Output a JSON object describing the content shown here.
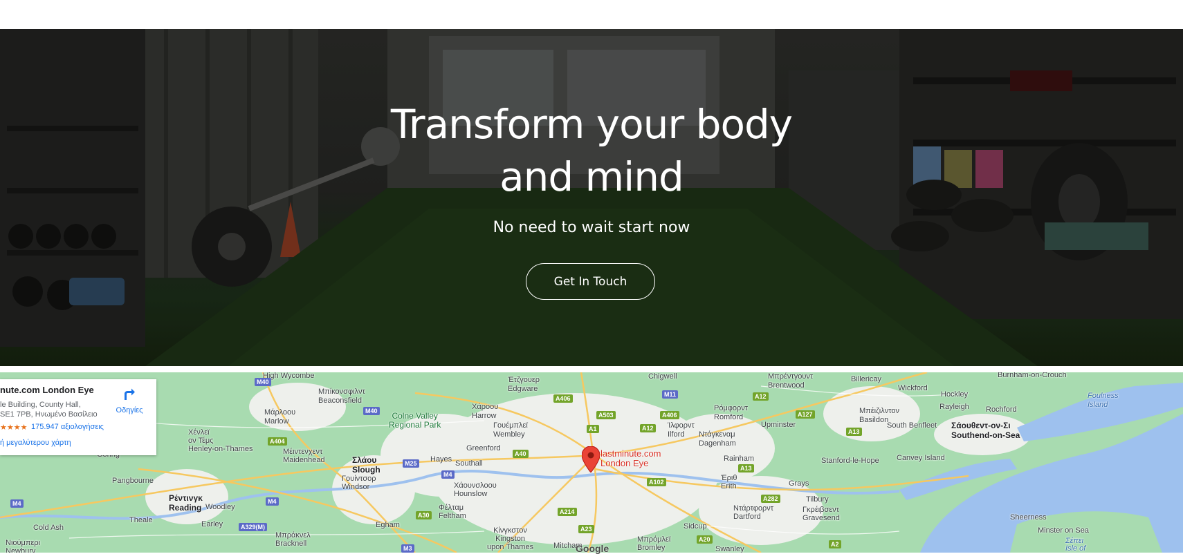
{
  "hero": {
    "title_line1": "Transform your body",
    "title_line2": "and mind",
    "subtitle": "No need to wait start now",
    "cta_label": "Get In Touch"
  },
  "map": {
    "place_card": {
      "name": "nute.com London Eye",
      "address_line1": "le Building, County Hall,",
      "address_line2": "SE1 7PB, Ηνωμένο Βασίλειο",
      "rating_stars": "★★★★",
      "reviews": "175.947 αξιολογήσεις",
      "larger_map": "ή μεγαλύτερου χάρτη",
      "directions_label": "Οδηγίες",
      "directions_icon": "directions-icon"
    },
    "pin_label_line1": "lastminute.com",
    "pin_label_line2": "London Eye",
    "google_logo": "Google",
    "labels": {
      "high_wycombe": "High Wycombe",
      "beaconsfield": "Μπίκονσφιλντ\nBeaconsfield",
      "edgware": "Έτζγουερ\nEdgware",
      "chigwell": "Chigwell",
      "brentwood": "Μπρέντγουντ\nBrentwood",
      "billericay": "Billericay",
      "wickford": "Wickford",
      "burnham": "Burnham-on-Crouch",
      "hockley": "Hockley",
      "rayleigh": "Rayleigh",
      "rochford": "Rochford",
      "foulness": "Foulness\nIsland",
      "basildon": "Μπέιζιλντον\nBasildon",
      "harrow": "Χάροου\nHarrow",
      "romford": "Ρόμφορντ\nRomford",
      "marlow": "Μάρλοου\nMarlow",
      "colne": "Colne Valley\nRegional Park",
      "wembley": "Γουέμπλεϊ\nWembley",
      "ilford": "Ίλφορντ\nIlford",
      "dagenham": "Ντάγκεναμ\nDagenham",
      "upminster": "Upminster",
      "south_benfleet": "South Benfleet",
      "southend": "Σάουθεντ-ον-Σι\nSouthend-on-Sea",
      "henley": "Χένλεϊ\nον Τέμς\nHenley-on-Thames",
      "maidenhead": "Μέιντενχεντ\nMaidenhead",
      "slough": "Σλάου\nSlough",
      "hayes": "Hayes",
      "greenford": "Greenford",
      "southall": "Southall",
      "rainham": "Rainham",
      "stanford": "Stanford-le-Hope",
      "canvey": "Canvey Island",
      "goring": "Goring",
      "pangbourne": "Pangbourne",
      "windsor": "Γουίντσορ\nWindsor",
      "hounslow": "Χάουνσλοου\nHounslow",
      "erith": "Έριθ\nErith",
      "grays": "Grays",
      "reading": "Ρέντινγκ\nReading",
      "woodley": "Woodley",
      "feltham": "Φέλταμ\nFeltham",
      "dartford": "Ντάρτφορντ\nDartford",
      "tilbury": "Tilbury",
      "gravesend": "Γκρέιβσεντ\nGravesend",
      "sheerness": "Sheerness",
      "theale": "Theale",
      "earley": "Earley",
      "egham": "Egham",
      "kingston": "Κίνγκστον\nKingston\nupon Thames",
      "sidcup": "Sidcup",
      "minster": "Minster on Sea",
      "cold_ash": "Cold Ash",
      "bracknell": "Μπράκνελ\nBracknell",
      "newbury": "Νιούμπερι\nNewbury",
      "mitcham": "Mitcham",
      "bromley": "Μπρόμλεϊ\nBromley",
      "swanley": "Swanley",
      "sheppey": "Σέπει\nIsle of"
    },
    "roads": {
      "m40a": "M40",
      "m40b": "M40",
      "m25": "M25",
      "m4a": "M4",
      "m4b": "M4",
      "m4c": "M4",
      "m3": "M3",
      "m11": "M11",
      "a406a": "A406",
      "a503": "A503",
      "a406b": "A406",
      "a12a": "A12",
      "a12b": "A12",
      "a127": "A127",
      "a13a": "A13",
      "a1": "A1",
      "a40": "A40",
      "a404": "A404",
      "a13b": "A13",
      "a102": "A102",
      "a282": "A282",
      "a30": "A30",
      "a214": "A214",
      "a23": "A23",
      "a329m": "A329(M)",
      "a20": "A20",
      "a2": "A2"
    },
    "colors": {
      "park": "#a8dbb0",
      "urban": "#eef0ec",
      "water": "#9ec1ee",
      "road": "#f6c860"
    }
  }
}
